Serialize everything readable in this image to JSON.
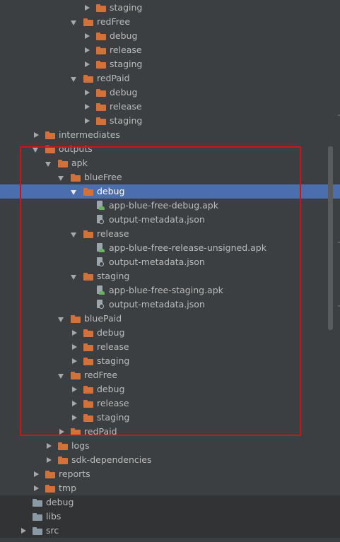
{
  "tree": {
    "rows": [
      {
        "label": "staging",
        "depth": 6,
        "arrow": "right",
        "icon": "folder",
        "color": "orange"
      },
      {
        "label": "redFree",
        "depth": 5,
        "arrow": "down",
        "icon": "folder",
        "color": "orange"
      },
      {
        "label": "debug",
        "depth": 6,
        "arrow": "right",
        "icon": "folder",
        "color": "orange"
      },
      {
        "label": "release",
        "depth": 6,
        "arrow": "right",
        "icon": "folder",
        "color": "orange"
      },
      {
        "label": "staging",
        "depth": 6,
        "arrow": "right",
        "icon": "folder",
        "color": "orange"
      },
      {
        "label": "redPaid",
        "depth": 5,
        "arrow": "down",
        "icon": "folder",
        "color": "orange"
      },
      {
        "label": "debug",
        "depth": 6,
        "arrow": "right",
        "icon": "folder",
        "color": "orange"
      },
      {
        "label": "release",
        "depth": 6,
        "arrow": "right",
        "icon": "folder",
        "color": "orange"
      },
      {
        "label": "staging",
        "depth": 6,
        "arrow": "right",
        "icon": "folder",
        "color": "orange"
      },
      {
        "label": "intermediates",
        "depth": 2,
        "arrow": "right",
        "icon": "folder",
        "color": "orange"
      },
      {
        "label": "outputs",
        "depth": 2,
        "arrow": "down",
        "icon": "folder",
        "color": "orange"
      },
      {
        "label": "apk",
        "depth": 3,
        "arrow": "down",
        "icon": "folder",
        "color": "orange"
      },
      {
        "label": "blueFree",
        "depth": 4,
        "arrow": "down",
        "icon": "folder",
        "color": "orange"
      },
      {
        "label": "debug",
        "depth": 5,
        "arrow": "down",
        "icon": "folder",
        "color": "orange",
        "selected": true
      },
      {
        "label": "app-blue-free-debug.apk",
        "depth": 6,
        "arrow": "none",
        "icon": "apk"
      },
      {
        "label": "output-metadata.json",
        "depth": 6,
        "arrow": "none",
        "icon": "json"
      },
      {
        "label": "release",
        "depth": 5,
        "arrow": "down",
        "icon": "folder",
        "color": "orange"
      },
      {
        "label": "app-blue-free-release-unsigned.apk",
        "depth": 6,
        "arrow": "none",
        "icon": "apk"
      },
      {
        "label": "output-metadata.json",
        "depth": 6,
        "arrow": "none",
        "icon": "json"
      },
      {
        "label": "staging",
        "depth": 5,
        "arrow": "down",
        "icon": "folder",
        "color": "orange"
      },
      {
        "label": "app-blue-free-staging.apk",
        "depth": 6,
        "arrow": "none",
        "icon": "apk"
      },
      {
        "label": "output-metadata.json",
        "depth": 6,
        "arrow": "none",
        "icon": "json"
      },
      {
        "label": "bluePaid",
        "depth": 4,
        "arrow": "down",
        "icon": "folder",
        "color": "orange"
      },
      {
        "label": "debug",
        "depth": 5,
        "arrow": "right",
        "icon": "folder",
        "color": "orange"
      },
      {
        "label": "release",
        "depth": 5,
        "arrow": "right",
        "icon": "folder",
        "color": "orange"
      },
      {
        "label": "staging",
        "depth": 5,
        "arrow": "right",
        "icon": "folder",
        "color": "orange"
      },
      {
        "label": "redFree",
        "depth": 4,
        "arrow": "down",
        "icon": "folder",
        "color": "orange"
      },
      {
        "label": "debug",
        "depth": 5,
        "arrow": "right",
        "icon": "folder",
        "color": "orange"
      },
      {
        "label": "release",
        "depth": 5,
        "arrow": "right",
        "icon": "folder",
        "color": "orange"
      },
      {
        "label": "staging",
        "depth": 5,
        "arrow": "right",
        "icon": "folder",
        "color": "orange"
      },
      {
        "label": "redPaid",
        "depth": 4,
        "arrow": "right",
        "icon": "folder",
        "color": "orange"
      },
      {
        "label": "logs",
        "depth": 3,
        "arrow": "right",
        "icon": "folder",
        "color": "orange"
      },
      {
        "label": "sdk-dependencies",
        "depth": 3,
        "arrow": "right",
        "icon": "folder",
        "color": "orange"
      },
      {
        "label": "reports",
        "depth": 2,
        "arrow": "right",
        "icon": "folder",
        "color": "orange"
      },
      {
        "label": "tmp",
        "depth": 2,
        "arrow": "right",
        "icon": "folder",
        "color": "orange"
      },
      {
        "label": "debug",
        "depth": 1,
        "arrow": "none",
        "icon": "folder",
        "color": "grey"
      },
      {
        "label": "libs",
        "depth": 1,
        "arrow": "none",
        "icon": "folder",
        "color": "grey"
      },
      {
        "label": "src",
        "depth": 1,
        "arrow": "right",
        "icon": "folder",
        "color": "grey"
      }
    ]
  },
  "colors": {
    "panel_background": "#3c3f41",
    "selection": "#4b6eaf",
    "folder_orange": "#d2713a",
    "folder_grey": "#8a9aa5",
    "highlight_border": "#d0131b"
  }
}
